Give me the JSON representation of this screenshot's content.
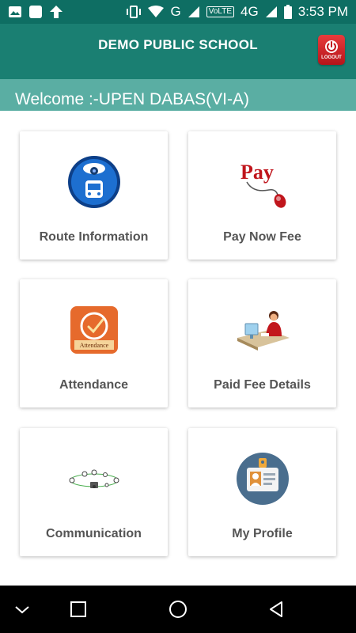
{
  "status_bar": {
    "network_label": "G",
    "volte_label": "VoLTE",
    "lte_label": "4G",
    "time": "3:53 PM"
  },
  "app_bar": {
    "title": "DEMO PUBLIC SCHOOL",
    "logout_label": "LOGOUT"
  },
  "welcome": {
    "text": "Welcome :-UPEN DABAS(VI-A)"
  },
  "tiles": [
    {
      "label": "Route Information",
      "icon": "bus-camera-icon"
    },
    {
      "label": "Pay Now Fee",
      "icon": "pay-mouse-icon"
    },
    {
      "label": "Attendance",
      "icon": "attendance-clock-icon"
    },
    {
      "label": "Paid Fee Details",
      "icon": "desk-person-icon"
    },
    {
      "label": "Communication",
      "icon": "communication-network-icon"
    },
    {
      "label": "My Profile",
      "icon": "id-badge-icon"
    }
  ],
  "colors": {
    "status_bar": "#0e6e63",
    "app_bar": "#1a7f72",
    "welcome_bar": "#5aaea3",
    "logout": "#d32027"
  }
}
